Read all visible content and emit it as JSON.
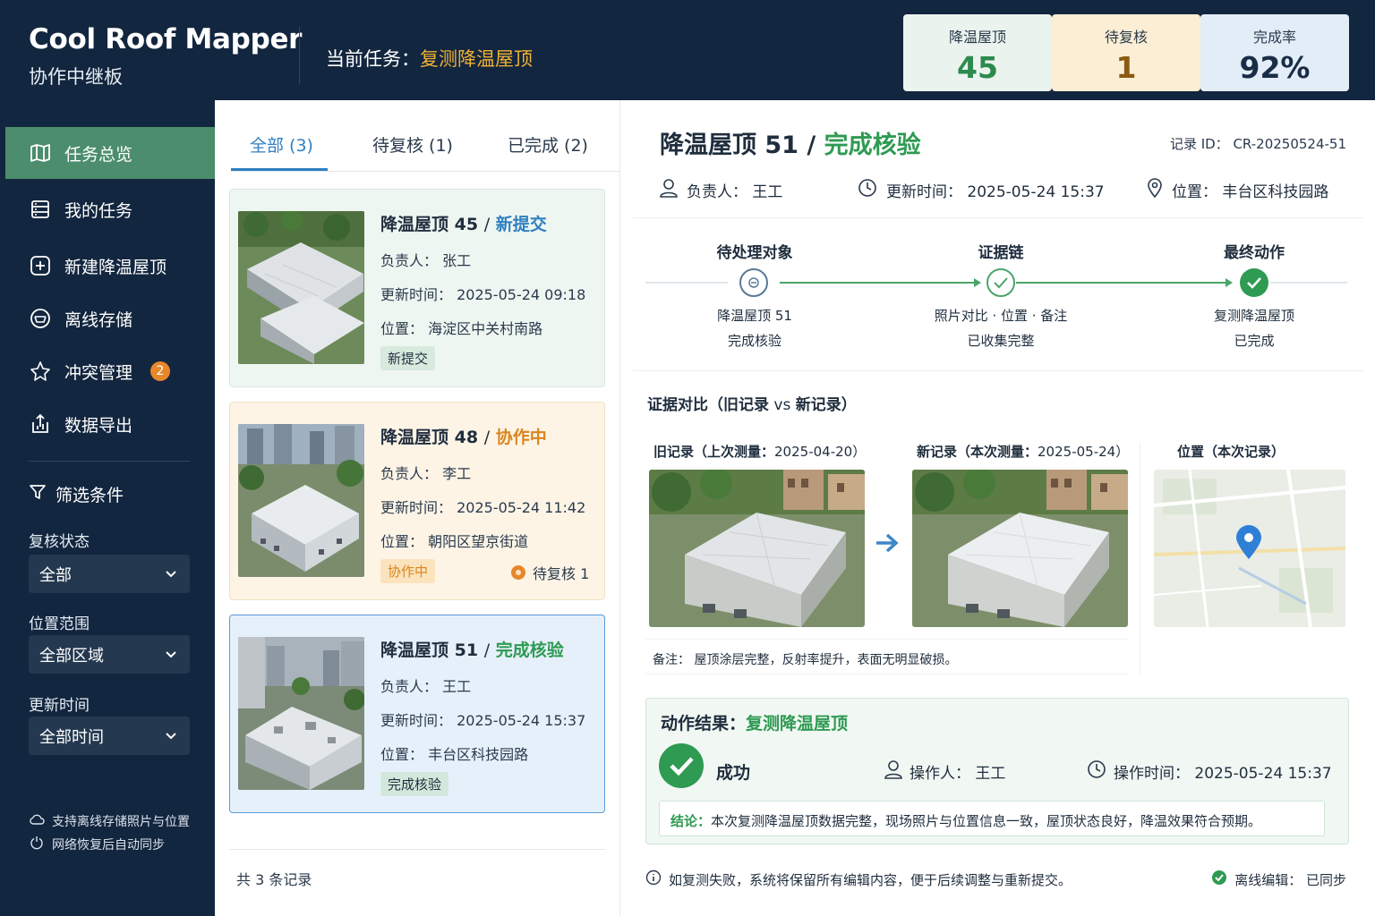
{
  "header": {
    "app_title": "Cool Roof Mapper",
    "app_subtitle": "协作中继板",
    "task_label": "当前任务：",
    "task_value": "复测降温屋顶",
    "stats": [
      {
        "label": "降温屋顶",
        "value": "45"
      },
      {
        "label": "待复核",
        "value": "1"
      },
      {
        "label": "完成率",
        "value": "92%"
      }
    ]
  },
  "sidebar": {
    "items": [
      {
        "label": "任务总览",
        "icon": "map-icon"
      },
      {
        "label": "我的任务",
        "icon": "list-icon"
      },
      {
        "label": "新建降温屋顶",
        "icon": "plus-square-icon"
      },
      {
        "label": "离线存储",
        "icon": "storage-icon"
      },
      {
        "label": "冲突管理",
        "icon": "conflict-icon",
        "badge": "2"
      },
      {
        "label": "数据导出",
        "icon": "export-icon"
      }
    ],
    "filters": {
      "title": "筛选条件",
      "status_label": "复核状态",
      "status_value": "全部",
      "location_label": "位置范围",
      "location_value": "全部区域",
      "time_label": "更新时间",
      "time_value": "全部时间"
    },
    "notes": [
      "支持离线存储照片与位置",
      "网络恢复后自动同步"
    ]
  },
  "list": {
    "tabs": [
      "全部 (3)",
      "待复核 (1)",
      "已完成 (2)"
    ],
    "cards": [
      {
        "name": "降温屋顶 45",
        "status": "新提交",
        "owner": "负责人：  张工",
        "updated": "更新时间：  2025-05-24 09:18",
        "location": "位置：  海淀区中关村南路",
        "tag": "新提交"
      },
      {
        "name": "降温屋顶 48",
        "status": "协作中",
        "owner": "负责人：  李工",
        "updated": "更新时间：  2025-05-24 11:42",
        "location": "位置：  朝阳区望京街道",
        "tag": "协作中",
        "extra": "待复核 1"
      },
      {
        "name": "降温屋顶 51",
        "status": "完成核验",
        "owner": "负责人：  王工",
        "updated": "更新时间：  2025-05-24 15:37",
        "location": "位置：  丰台区科技园路",
        "tag": "完成核验"
      }
    ],
    "count": "共 3 条记录"
  },
  "detail": {
    "title_name": "降温屋顶 51 /",
    "title_status": "完成核验",
    "record_id": "记录 ID：  CR-20250524-51",
    "owner": "负责人：  王工",
    "updated": "更新时间：  2025-05-24 15:37",
    "location": "位置：  丰台区科技园路",
    "steps": [
      {
        "title": "待处理对象",
        "line1": "降温屋顶 51",
        "line2": "完成核验"
      },
      {
        "title": "证据链",
        "line1": "照片对比 · 位置 · 备注",
        "line2": "已收集完整"
      },
      {
        "title": "最终动作",
        "line1": "复测降温屋顶",
        "line2": "已完成"
      }
    ],
    "evidence_title": "证据对比（旧记录",
    "evidence_vs": " vs ",
    "evidence_title2": "新记录）",
    "old_label": "旧记录（上次测量：",
    "old_date": "2025-04-20）",
    "new_label": "新记录（本次测量：",
    "new_date": "2025-05-24）",
    "loc_label": "位置（本次记录）",
    "note": "备注：  屋顶涂层完整，反射率提升，表面无明显破损。",
    "result": {
      "title": "动作结果：",
      "action": "复测降温屋顶",
      "status": "成功",
      "operator": "操作人：  王工",
      "time": "操作时间：  2025-05-24 15:37",
      "conclusion_label": "结论：",
      "conclusion": "本次复测降温屋顶数据完整，现场照片与位置信息一致，屋顶状态良好，降温效果符合预期。"
    },
    "footer_note": "如复测失败，系统将保留所有编辑内容，便于后续调整与重新提交。",
    "sync_status": "离线编辑：  已同步"
  },
  "colors": {
    "header_bg": "#13263f",
    "accent_green": "#2e9a52",
    "accent_blue": "#2f7fc1",
    "accent_orange": "#e8872a",
    "highlight": "#f2b233"
  }
}
